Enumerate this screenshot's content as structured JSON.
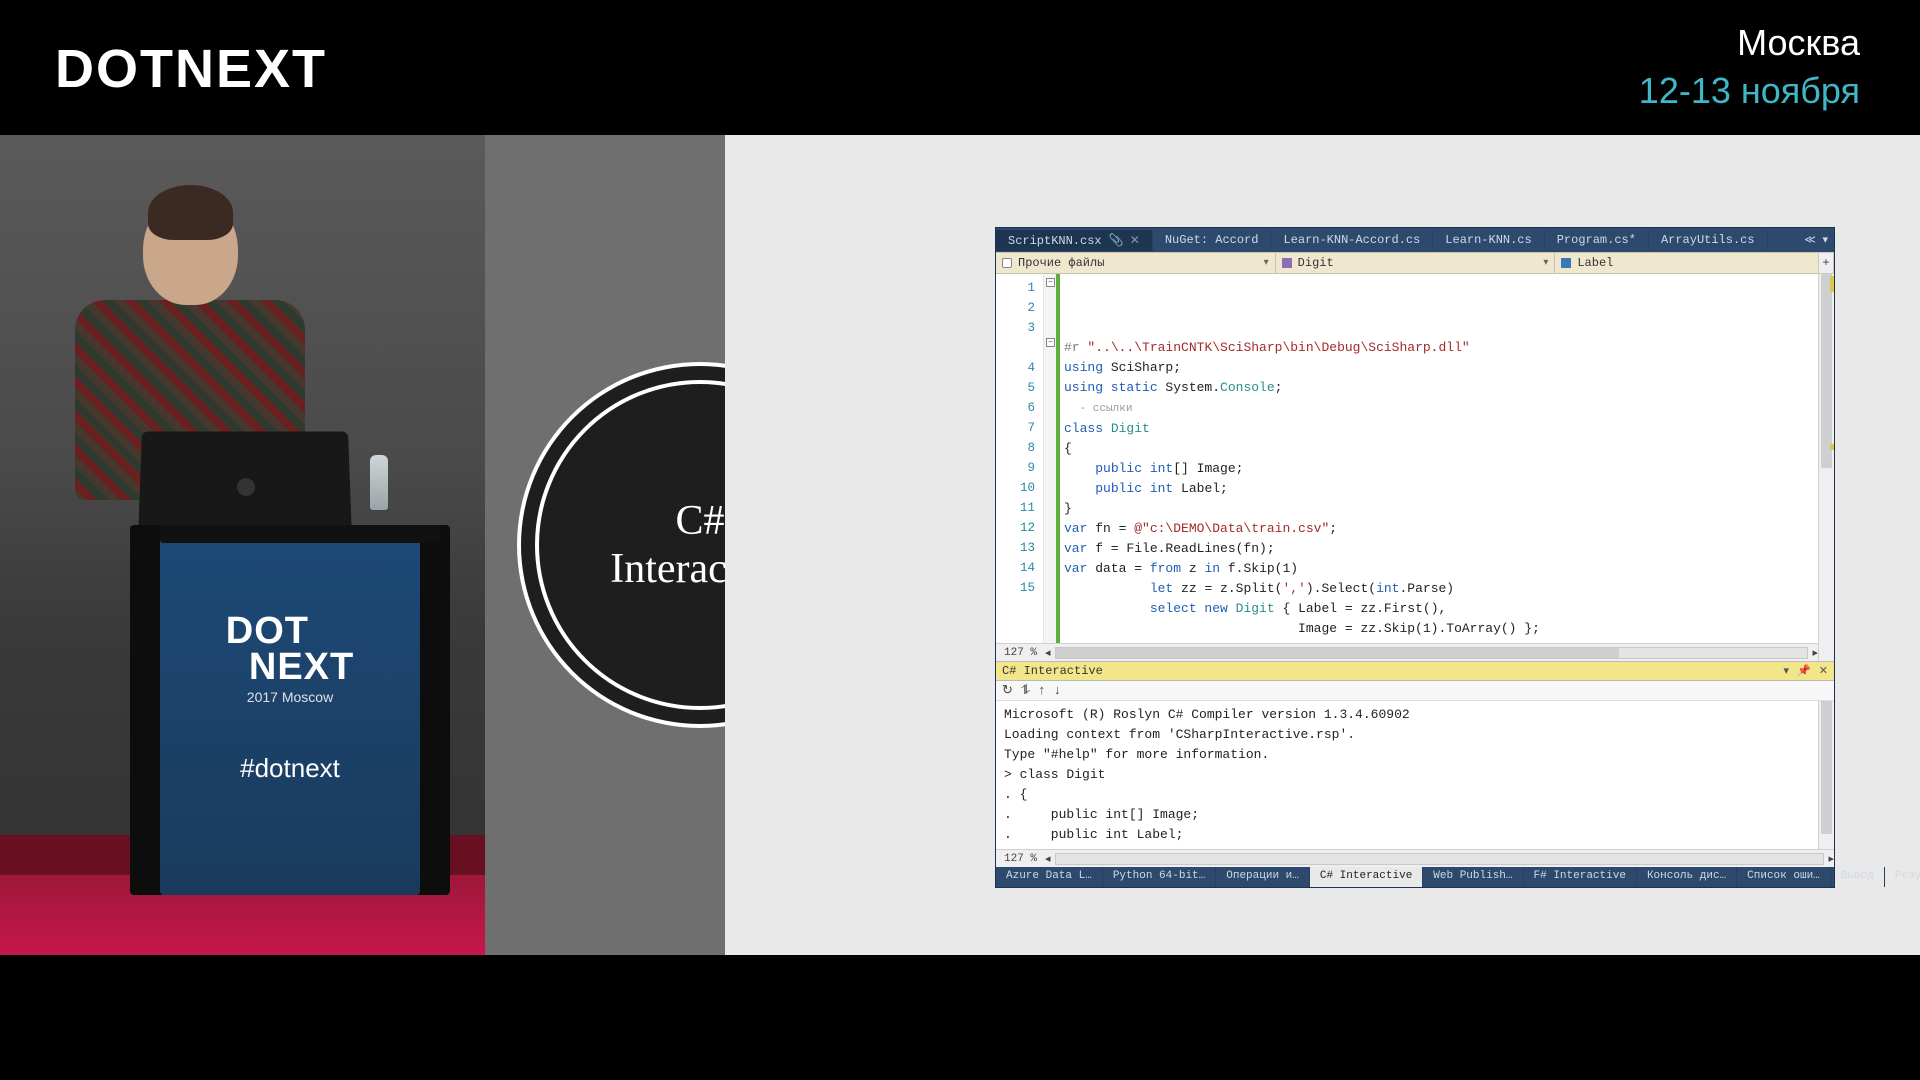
{
  "banner": {
    "brand": "DOTNEXT",
    "location": "Москва",
    "date": "12-13 ноября"
  },
  "podium": {
    "line1": "DOT",
    "line2": "NEXT",
    "sub": "2017 Moscow",
    "hashtag": "#dotnext"
  },
  "circle": {
    "line1": "C#",
    "line2": "Interactive"
  },
  "ide": {
    "tabs": [
      {
        "label": "ScriptKNN.csx",
        "active": true,
        "pinned": true
      },
      {
        "label": "NuGet: Accord",
        "active": false
      },
      {
        "label": "Learn-KNN-Accord.cs",
        "active": false
      },
      {
        "label": "Learn-KNN.cs",
        "active": false
      },
      {
        "label": "Program.cs*",
        "active": false
      },
      {
        "label": "ArrayUtils.cs",
        "active": false
      }
    ],
    "tabs_scroll": "≪  ▾",
    "combo_left": "Прочие файлы",
    "combo_mid": "Digit",
    "combo_right": "Label",
    "zoom": "127 %",
    "plus": "+",
    "code_lines": [
      {
        "n": 1,
        "html": "<span class='tok-dir'>#r</span> <span class='tok-str'>\"..\\..\\TrainCNTK\\SciSharp\\bin\\Debug\\SciSharp.dll\"</span>"
      },
      {
        "n": 2,
        "html": "<span class='tok-key'>using</span> SciSharp;"
      },
      {
        "n": 3,
        "html": "<span class='tok-key'>using static</span> System.<span class='tok-type'>Console</span>;"
      },
      {
        "n": 0,
        "html": "  <span class='tok-comment'>- ссылки</span>"
      },
      {
        "n": 4,
        "html": "<span class='tok-key'>class</span> <span class='tok-type'>Digit</span>"
      },
      {
        "n": 5,
        "html": "{"
      },
      {
        "n": 6,
        "html": "    <span class='tok-key'>public int</span>[] Image;"
      },
      {
        "n": 7,
        "html": "    <span class='tok-key'>public int</span> Label;"
      },
      {
        "n": 8,
        "html": "}"
      },
      {
        "n": 9,
        "html": ""
      },
      {
        "n": 10,
        "html": "<span class='tok-key'>var</span> fn = <span class='tok-str'>@\"c:\\DEMO\\Data\\train.csv\"</span>;"
      },
      {
        "n": 11,
        "html": "<span class='tok-key'>var</span> f = File.ReadLines(fn);"
      },
      {
        "n": 12,
        "html": "<span class='tok-key'>var</span> data = <span class='tok-key'>from</span> z <span class='tok-key'>in</span> f.Skip(1)"
      },
      {
        "n": 13,
        "html": "           <span class='tok-key'>let</span> zz = z.Split(<span class='tok-str'>','</span>).Select(<span class='tok-key'>int</span>.Parse)"
      },
      {
        "n": 14,
        "html": "           <span class='tok-key'>select new</span> <span class='tok-type'>Digit</span> { Label = zz.First(),"
      },
      {
        "n": 15,
        "html": "                              Image = zz.Skip(1).ToArray() };"
      }
    ],
    "interactive": {
      "title": "C# Interactive",
      "tool_icons": "↻  ⥮  ↑  ↓",
      "zoom": "127 %",
      "lines": [
        "Microsoft (R) Roslyn C# Compiler version 1.3.4.60902",
        "Loading context from 'CSharpInteractive.rsp'.",
        "Type \"#help\" for more information.",
        "> class Digit",
        ". {",
        ".     public int[] Image;",
        ".     public int Label;"
      ]
    },
    "tool_tabs": [
      {
        "label": "Azure Data L…",
        "active": false
      },
      {
        "label": "Python 64-bit…",
        "active": false
      },
      {
        "label": "Операции и…",
        "active": false
      },
      {
        "label": "C# Interactive",
        "active": true
      },
      {
        "label": "Web Publish…",
        "active": false
      },
      {
        "label": "F# Interactive",
        "active": false
      },
      {
        "label": "Консоль дис…",
        "active": false
      },
      {
        "label": "Список оши…",
        "active": false
      },
      {
        "label": "Вывод",
        "active": false
      },
      {
        "label": "Результаты п…",
        "active": false
      }
    ]
  }
}
